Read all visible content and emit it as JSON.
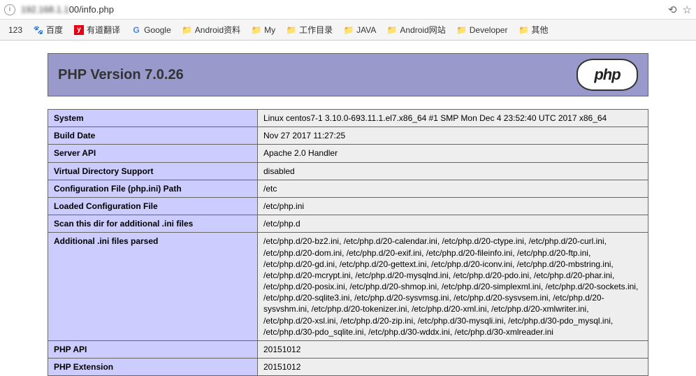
{
  "address": {
    "url_visible": "00/info.php"
  },
  "bookmarks": [
    {
      "label": "123"
    },
    {
      "label": "百度",
      "icon": "baidu"
    },
    {
      "label": "有道翻译",
      "icon": "youdao"
    },
    {
      "label": "Google",
      "icon": "google"
    },
    {
      "label": "Android资料",
      "icon": "folder"
    },
    {
      "label": "My",
      "icon": "folder"
    },
    {
      "label": "工作目录",
      "icon": "folder"
    },
    {
      "label": "JAVA",
      "icon": "folder"
    },
    {
      "label": "Android网站",
      "icon": "folder"
    },
    {
      "label": "Developer",
      "icon": "folder"
    },
    {
      "label": "其他",
      "icon": "folder"
    }
  ],
  "phpinfo": {
    "title": "PHP Version 7.0.26",
    "rows": [
      {
        "k": "System",
        "v": "Linux centos7-1 3.10.0-693.11.1.el7.x86_64 #1 SMP Mon Dec 4 23:52:40 UTC 2017 x86_64"
      },
      {
        "k": "Build Date",
        "v": "Nov 27 2017 11:27:25"
      },
      {
        "k": "Server API",
        "v": "Apache 2.0 Handler"
      },
      {
        "k": "Virtual Directory Support",
        "v": "disabled"
      },
      {
        "k": "Configuration File (php.ini) Path",
        "v": "/etc"
      },
      {
        "k": "Loaded Configuration File",
        "v": "/etc/php.ini"
      },
      {
        "k": "Scan this dir for additional .ini files",
        "v": "/etc/php.d"
      },
      {
        "k": "Additional .ini files parsed",
        "v": "/etc/php.d/20-bz2.ini, /etc/php.d/20-calendar.ini, /etc/php.d/20-ctype.ini, /etc/php.d/20-curl.ini, /etc/php.d/20-dom.ini, /etc/php.d/20-exif.ini, /etc/php.d/20-fileinfo.ini, /etc/php.d/20-ftp.ini, /etc/php.d/20-gd.ini, /etc/php.d/20-gettext.ini, /etc/php.d/20-iconv.ini, /etc/php.d/20-mbstring.ini, /etc/php.d/20-mcrypt.ini, /etc/php.d/20-mysqlnd.ini, /etc/php.d/20-pdo.ini, /etc/php.d/20-phar.ini, /etc/php.d/20-posix.ini, /etc/php.d/20-shmop.ini, /etc/php.d/20-simplexml.ini, /etc/php.d/20-sockets.ini, /etc/php.d/20-sqlite3.ini, /etc/php.d/20-sysvmsg.ini, /etc/php.d/20-sysvsem.ini, /etc/php.d/20-sysvshm.ini, /etc/php.d/20-tokenizer.ini, /etc/php.d/20-xml.ini, /etc/php.d/20-xmlwriter.ini, /etc/php.d/20-xsl.ini, /etc/php.d/20-zip.ini, /etc/php.d/30-mysqli.ini, /etc/php.d/30-pdo_mysql.ini, /etc/php.d/30-pdo_sqlite.ini, /etc/php.d/30-wddx.ini, /etc/php.d/30-xmlreader.ini"
      },
      {
        "k": "PHP API",
        "v": "20151012"
      },
      {
        "k": "PHP Extension",
        "v": "20151012"
      }
    ]
  }
}
